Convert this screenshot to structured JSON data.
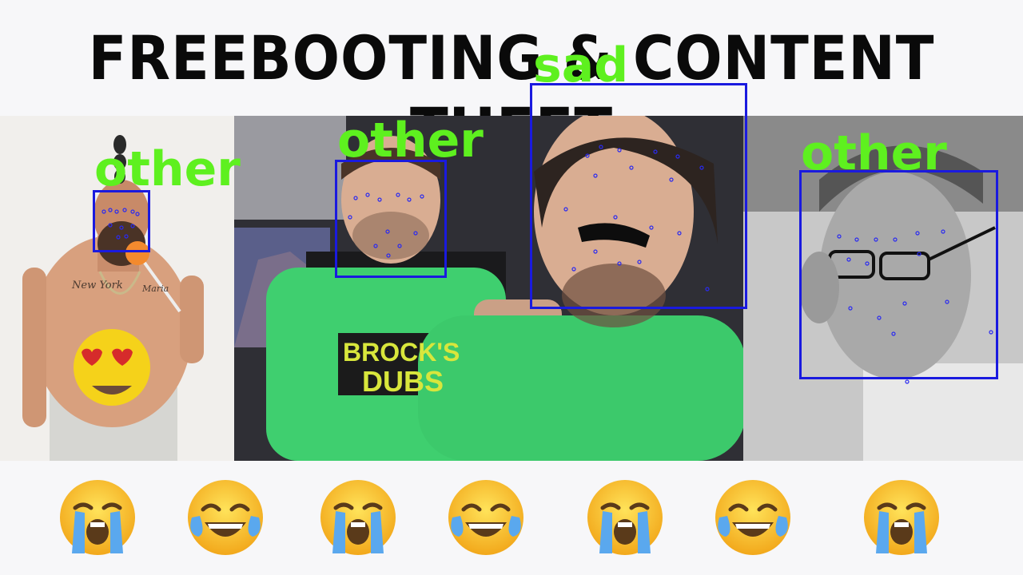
{
  "header": {
    "title": "FREEBOOTING & CONTENT THEFT"
  },
  "photos": {
    "shirt_text_line1": "BROCK'S",
    "shirt_text_line2": "DUBS",
    "tattoo_left": "New York",
    "tattoo_right": "Maria"
  },
  "detections": [
    {
      "label": "other"
    },
    {
      "label": "other"
    },
    {
      "label": "sad"
    },
    {
      "label": "other"
    }
  ],
  "emoji_row": [
    "loudly-crying-face",
    "face-with-tears-of-joy",
    "loudly-crying-face",
    "face-with-tears-of-joy",
    "loudly-crying-face",
    "face-with-tears-of-joy",
    "loudly-crying-face"
  ],
  "colors": {
    "box": "#1a1adf",
    "label": "#5ef01f",
    "shirt": "#3fcf6f"
  }
}
